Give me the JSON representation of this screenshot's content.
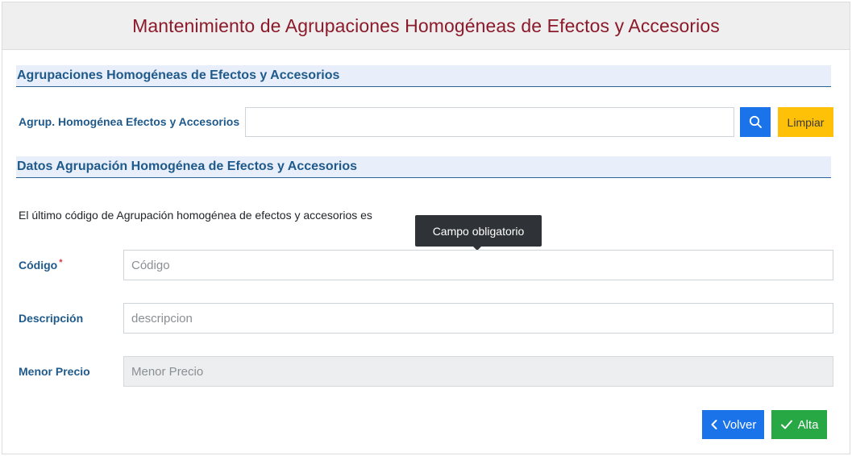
{
  "page": {
    "title": "Mantenimiento de Agrupaciones Homogéneas de Efectos y Accesorios"
  },
  "search_section": {
    "title": "Agrupaciones Homogéneas de Efectos y Accesorios",
    "field_label": "Agrup. Homogénea Efectos y Accesorios",
    "field_value": "",
    "search_icon": "search-icon",
    "clear_label": "Limpiar"
  },
  "data_section": {
    "title": "Datos Agrupación Homogénea de Efectos y Accesorios",
    "info_text": "El último código de Agrupación homogénea de efectos y accesorios es",
    "tooltip": "Campo obligatorio",
    "required_mark": "*",
    "fields": {
      "codigo": {
        "label": "Código",
        "placeholder": "Código",
        "value": ""
      },
      "descripcion": {
        "label": "Descripción",
        "placeholder": "descripcion",
        "value": ""
      },
      "menor_precio": {
        "label": "Menor Precio",
        "placeholder": "Menor Precio",
        "value": "",
        "disabled": true
      }
    }
  },
  "actions": {
    "back_label": "Volver",
    "back_icon": "chevron-left-icon",
    "add_label": "Alta",
    "add_icon": "check-icon"
  },
  "colors": {
    "title": "#8b1a2b",
    "section_text": "#1f5a8b",
    "primary": "#1a73e8",
    "warning": "#ffc107",
    "success": "#28a745",
    "required": "#dc3545"
  }
}
